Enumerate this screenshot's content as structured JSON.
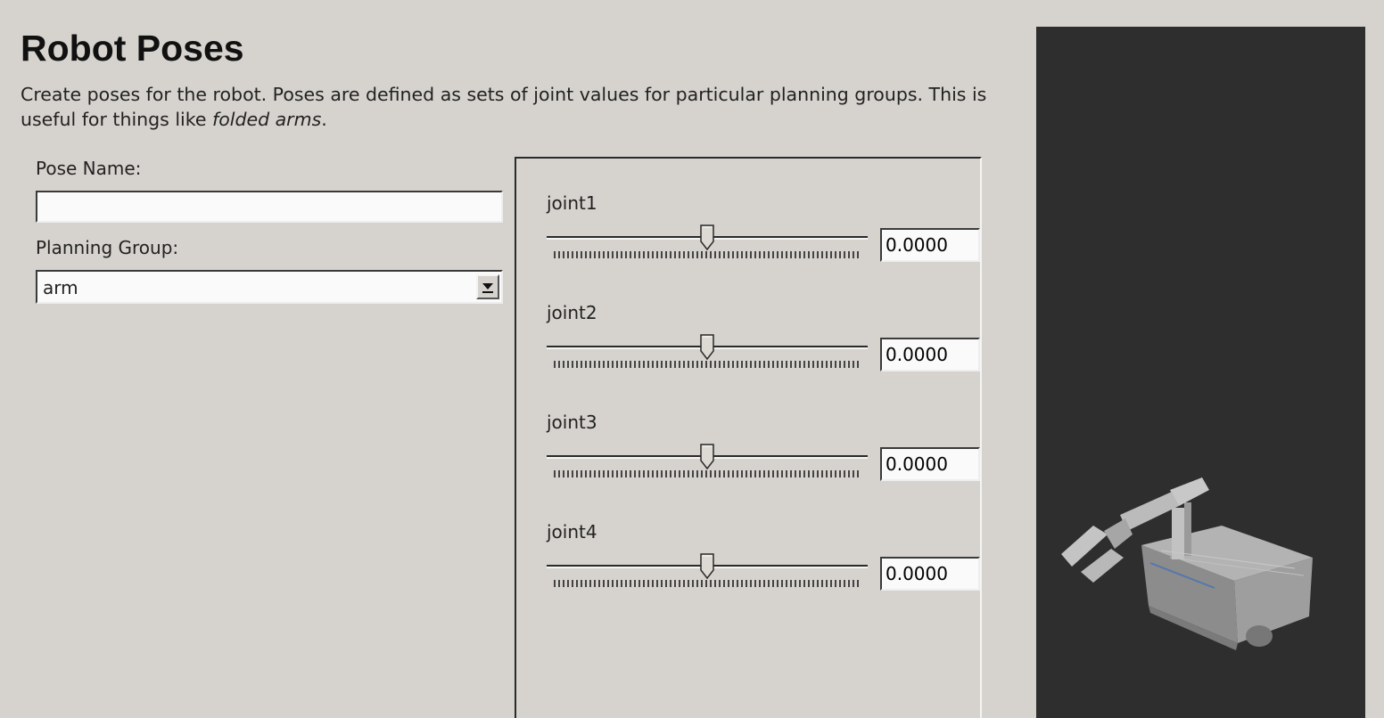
{
  "page": {
    "title": "Robot Poses",
    "description_start": "Create poses for the robot. Poses are defined as sets of joint values for particular planning groups. This is useful for things like ",
    "description_emphasis": "folded arms",
    "description_end": "."
  },
  "form": {
    "pose_name_label": "Pose Name:",
    "pose_name_value": "",
    "planning_group_label": "Planning Group:",
    "planning_group_value": "arm"
  },
  "joints": [
    {
      "name": "joint1",
      "value": "0.0000",
      "slider_fraction": 0.5
    },
    {
      "name": "joint2",
      "value": "0.0000",
      "slider_fraction": 0.5
    },
    {
      "name": "joint3",
      "value": "0.0000",
      "slider_fraction": 0.5
    },
    {
      "name": "joint4",
      "value": "0.0000",
      "slider_fraction": 0.5
    }
  ],
  "icons": {
    "combo_arrow": "chevron-down-icon",
    "viewer_model": "robot-model-icon"
  },
  "colors": {
    "window_bg": "#d6d3ce",
    "viewer_bg": "#2e2e2e",
    "input_bg": "#fafafa"
  }
}
